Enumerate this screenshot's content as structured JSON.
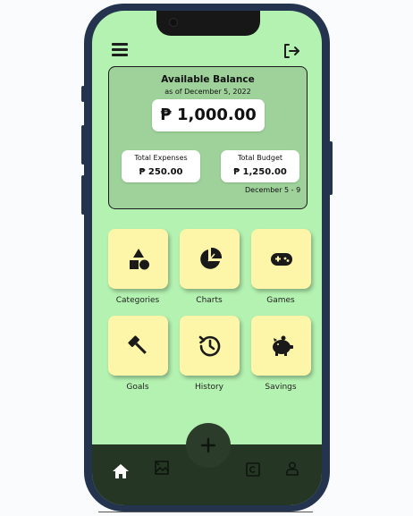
{
  "balance": {
    "title": "Available Balance",
    "as_of": "as of December 5, 2022",
    "amount": "₱ 1,000.00"
  },
  "expenses": {
    "label": "Total Expenses",
    "amount": "₱ 250.00"
  },
  "budget": {
    "label": "Total Budget",
    "amount": "₱ 1,250.00",
    "range": "December 5 - 9"
  },
  "tiles": [
    {
      "label": "Categories",
      "icon": "shapes-icon"
    },
    {
      "label": "Charts",
      "icon": "pie-chart-icon"
    },
    {
      "label": "Games",
      "icon": "gamepad-icon"
    },
    {
      "label": "Goals",
      "icon": "gavel-icon"
    },
    {
      "label": "History",
      "icon": "history-icon"
    },
    {
      "label": "Savings",
      "icon": "piggy-bank-icon"
    }
  ],
  "nav": [
    "home-icon",
    "image-icon",
    "add-icon",
    "wallet-icon",
    "profile-icon"
  ],
  "colors": {
    "screen_bg": "#b4f2b1",
    "card_bg": "#9ed29a",
    "tile_bg": "#fdf5a8",
    "bottom_bar": "#263625",
    "phone_frame": "#24344f"
  }
}
